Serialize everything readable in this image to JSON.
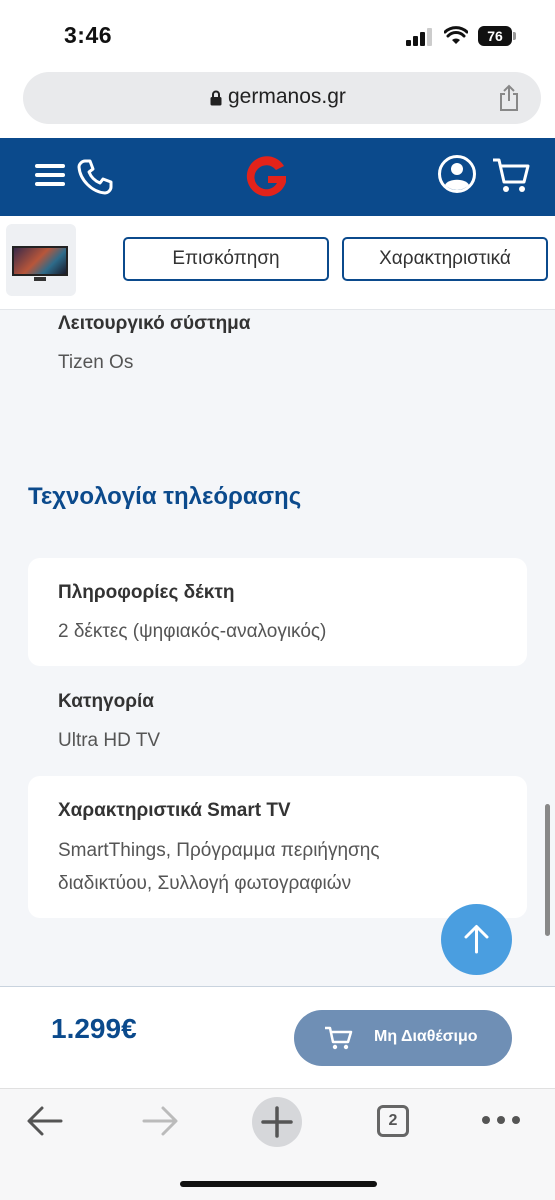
{
  "status_bar": {
    "time": "3:46",
    "battery": "76"
  },
  "browser": {
    "url": "germanos.gr"
  },
  "tabs": {
    "overview": "Επισκόπηση",
    "specs": "Χαρακτηριστικά"
  },
  "specs_top": {
    "os_label": "Λειτουργικό σύστημα",
    "os_value": "Tizen Os"
  },
  "tv_tech": {
    "title": "Τεχνολογία τηλεόρασης",
    "receiver_label": "Πληροφορίες δέκτη",
    "receiver_value": "2 δέκτες (ψηφιακός-αναλογικός)",
    "category_label": "Κατηγορία",
    "category_value": "Ultra HD TV",
    "smart_label": "Χαρακτηριστικά Smart TV",
    "smart_value_line1": "SmartThings, Πρόγραμμα περιήγησης",
    "smart_value_line2": "διαδικτύου, Συλλογή φωτογραφιών"
  },
  "buy_bar": {
    "price": "1.299€",
    "button_label": "Μη Διαθέσιμο"
  },
  "toolbar": {
    "tab_count": "2"
  },
  "colors": {
    "brand_blue": "#0b4a8c",
    "button_disabled": "#6f8fb5",
    "scroll_top": "#4a9ee0",
    "logo_red": "#e2231a"
  }
}
